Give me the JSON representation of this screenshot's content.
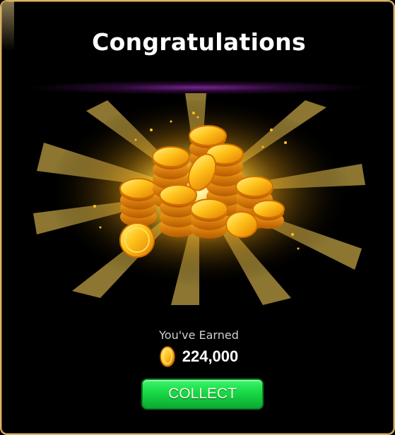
{
  "dialog": {
    "title": "Congratulations",
    "earned_label": "You've Earned",
    "amount": "224,000",
    "collect_label": "COLLECT"
  },
  "colors": {
    "border": "#d9b36a",
    "button_green": "#18d945",
    "glow": "#ffcc33",
    "coin": "#f5a623"
  },
  "icons": {
    "currency": "gold-coin-icon",
    "illustration": "coin-pile-illustration"
  }
}
